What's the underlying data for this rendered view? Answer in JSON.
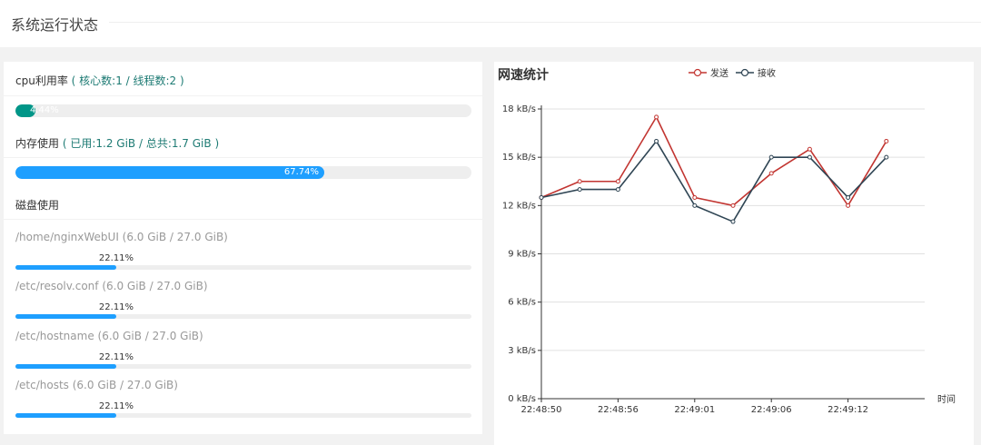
{
  "header": {
    "title": "系统运行状态"
  },
  "cpu": {
    "label": "cpu利用率",
    "hint": "( 核心数:1 / 线程数:2 )",
    "percent": 4.44,
    "percent_label": "4.44%"
  },
  "memory": {
    "label": "内存使用",
    "hint": "( 已用:1.2 GiB / 总共:1.7 GiB )",
    "percent": 67.74,
    "percent_label": "67.74%"
  },
  "disk": {
    "label": "磁盘使用",
    "items": [
      {
        "path": "/home/nginxWebUI (6.0 GiB / 27.0 GiB)",
        "percent": 22.11,
        "percent_label": "22.11%"
      },
      {
        "path": "/etc/resolv.conf (6.0 GiB / 27.0 GiB)",
        "percent": 22.11,
        "percent_label": "22.11%"
      },
      {
        "path": "/etc/hostname (6.0 GiB / 27.0 GiB)",
        "percent": 22.11,
        "percent_label": "22.11%"
      },
      {
        "path": "/etc/hosts (6.0 GiB / 27.0 GiB)",
        "percent": 22.11,
        "percent_label": "22.11%"
      }
    ]
  },
  "colors": {
    "cpu_bar": "#009688",
    "mem_bar": "#1e9fff",
    "disk_bar": "#1e9fff",
    "send_line": "#c23531",
    "recv_line": "#2f4554"
  },
  "chart_data": {
    "type": "line",
    "title": "网速统计",
    "xlabel": "时间",
    "ylabel": "",
    "ylim": [
      0,
      18
    ],
    "y_ticks": [
      "0 kB/s",
      "3 kB/s",
      "6 kB/s",
      "9 kB/s",
      "12 kB/s",
      "15 kB/s",
      "18 kB/s"
    ],
    "x_tick_labels": [
      "22:48:50",
      "22:48:56",
      "22:49:01",
      "22:49:06",
      "22:49:12"
    ],
    "x_tick_positions": [
      0,
      2,
      4,
      6,
      8
    ],
    "point_count": 11,
    "grid": true,
    "legend": "top-center",
    "series": [
      {
        "name": "发送",
        "values": [
          12.5,
          13.5,
          13.5,
          17.5,
          12.5,
          12.0,
          14.0,
          15.5,
          12.0,
          16.0
        ]
      },
      {
        "name": "接收",
        "values": [
          12.5,
          13.0,
          13.0,
          16.0,
          12.0,
          11.0,
          15.0,
          15.0,
          12.5,
          15.0
        ]
      }
    ]
  }
}
